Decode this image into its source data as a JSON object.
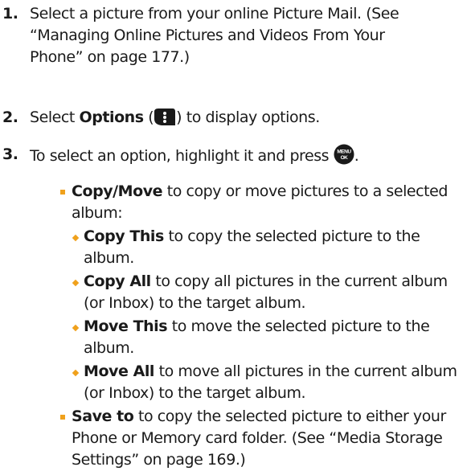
{
  "steps": [
    {
      "num": "1.",
      "line1": "Select a picture from your online Picture Mail. (See",
      "line2": "“Managing Online Pictures and Videos From Your",
      "line3": "Phone” on page 177.)"
    },
    {
      "num": "2.",
      "pre": "Select ",
      "bold": "Options",
      "mid": " (",
      "post": ") to display options.",
      "icon": "options-softkey-icon"
    },
    {
      "num": "3.",
      "pre": "To select an option, highlight it and press ",
      "post": ".",
      "icon": "menu-ok-key-icon",
      "icon_text_top": "MENU",
      "icon_text_bottom": "OK"
    }
  ],
  "options": [
    {
      "bold": "Copy/Move",
      "line1": " to copy or move pictures to a selected",
      "line2": "album:",
      "sub": [
        {
          "bold": "Copy This",
          "line1": " to copy the selected picture to the",
          "line2": "album."
        },
        {
          "bold": "Copy All",
          "line1": " to copy all pictures in the current album",
          "line2": "(or Inbox) to the target album."
        },
        {
          "bold": "Move This",
          "line1": " to move the selected picture to the",
          "line2": "album."
        },
        {
          "bold": "Move All",
          "line1": " to move all pictures in the current album",
          "line2": "(or Inbox) to the target album."
        }
      ]
    },
    {
      "bold": "Save to",
      "line1": " to copy the selected picture to either your",
      "line2": "Phone or Memory card folder. (See “Media Storage",
      "line3": "Settings” on page 169.)"
    }
  ],
  "colors": {
    "bullet": "#f0a11c",
    "text": "#1a1a1a",
    "icon_fill": "#1a1a1a"
  }
}
